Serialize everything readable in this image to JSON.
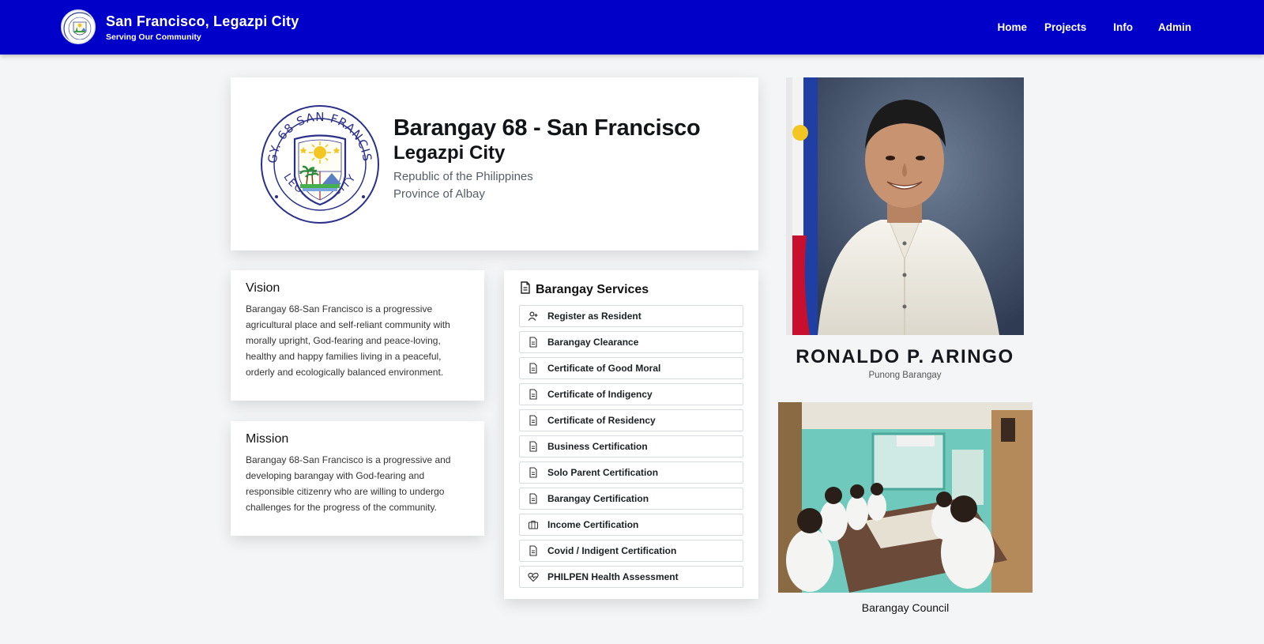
{
  "header": {
    "title": "San Francisco, Legazpi City",
    "subtitle": "Serving Our Community",
    "nav": [
      {
        "label": "Home"
      },
      {
        "label": "Projects"
      },
      {
        "label": "Info"
      },
      {
        "label": "Admin"
      }
    ],
    "bg_color": "#0000c8"
  },
  "hero": {
    "seal_text_top": "BRGY. 68 SAN FRANCISCO",
    "seal_text_bottom": "LEGAZPI CITY",
    "title": "Barangay 68 - San Francisco",
    "city": "Legazpi City",
    "line1": "Republic of the Philippines",
    "line2": "Province of Albay"
  },
  "vision": {
    "heading": "Vision",
    "text": "Barangay 68-San Francisco is a progressive agricultural place and self-reliant community with morally upright, God-fearing and peace-loving, healthy and happy families living in a peaceful, orderly and ecologically balanced environment."
  },
  "mission": {
    "heading": "Mission",
    "text": "Barangay 68-San Francisco is a progressive and developing barangay with God-fearing and responsible citizenry who are willing to undergo challenges for the progress of the community."
  },
  "services": {
    "heading": "Barangay Services",
    "items": [
      {
        "label": "Register as Resident",
        "icon": "user-plus-icon"
      },
      {
        "label": "Barangay Clearance",
        "icon": "document-icon"
      },
      {
        "label": "Certificate of Good Moral",
        "icon": "document-icon"
      },
      {
        "label": "Certificate of Indigency",
        "icon": "document-icon"
      },
      {
        "label": "Certificate of Residency",
        "icon": "document-icon"
      },
      {
        "label": "Business Certification",
        "icon": "document-icon"
      },
      {
        "label": "Solo Parent Certification",
        "icon": "document-icon"
      },
      {
        "label": "Barangay Certification",
        "icon": "document-icon"
      },
      {
        "label": "Income Certification",
        "icon": "briefcase-icon"
      },
      {
        "label": "Covid / Indigent Certification",
        "icon": "document-icon"
      },
      {
        "label": "PHILPEN Health Assessment",
        "icon": "heart-pulse-icon"
      }
    ]
  },
  "official": {
    "name": "RONALDO P. ARINGO",
    "role": "Punong Barangay"
  },
  "council": {
    "caption": "Barangay Council"
  }
}
